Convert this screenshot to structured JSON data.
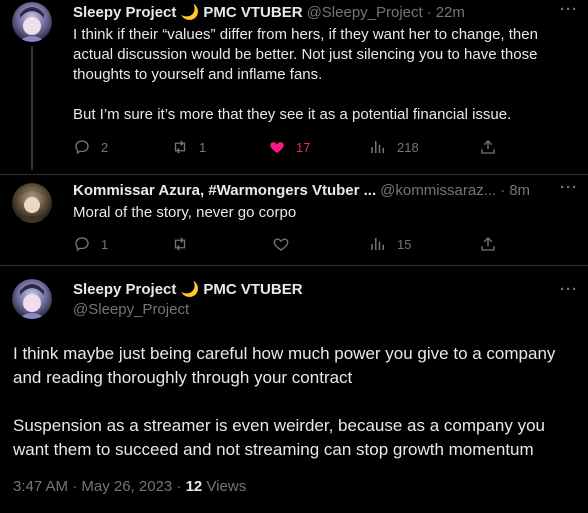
{
  "post1": {
    "name": "Sleepy Project 🌙 PMC VTUBER",
    "handle": "@Sleepy_Project",
    "time": "22m",
    "text_para1": "I think if their “values” differ from hers, if they want her to change, then actual discussion would be better. Not just silencing you to have those thoughts to yourself and inflame fans.",
    "text_para2": "But I’m sure it’s more that they see it as a potential financial issue.",
    "replies": "2",
    "reposts": "1",
    "likes": "17",
    "views": "218"
  },
  "post2": {
    "name": "Kommissar Azura, #Warmongers Vtuber ...",
    "handle": "@kommissaraz...",
    "time": "8m",
    "text": "Moral of the story, never go corpo",
    "replies": "1",
    "views": "15"
  },
  "post3": {
    "name": "Sleepy Project 🌙 PMC VTUBER",
    "handle": "@Sleepy_Project",
    "text_para1": "I think maybe just being careful how much power you give to a company and reading thoroughly through your contract",
    "text_para2": "Suspension as a streamer is even weirder, because as a company you want them to succeed and not streaming can stop growth momentum",
    "timestamp": "3:47 AM · May 26, 2023 · ",
    "views_count": "12",
    "views_label": " Views"
  },
  "colors": {
    "background": "#000000",
    "text": "#e7e9ea",
    "muted": "#71767b",
    "like": "#f91880"
  },
  "icons": [
    "reply-icon",
    "repost-icon",
    "like-icon",
    "views-icon",
    "share-icon",
    "more-icon"
  ]
}
